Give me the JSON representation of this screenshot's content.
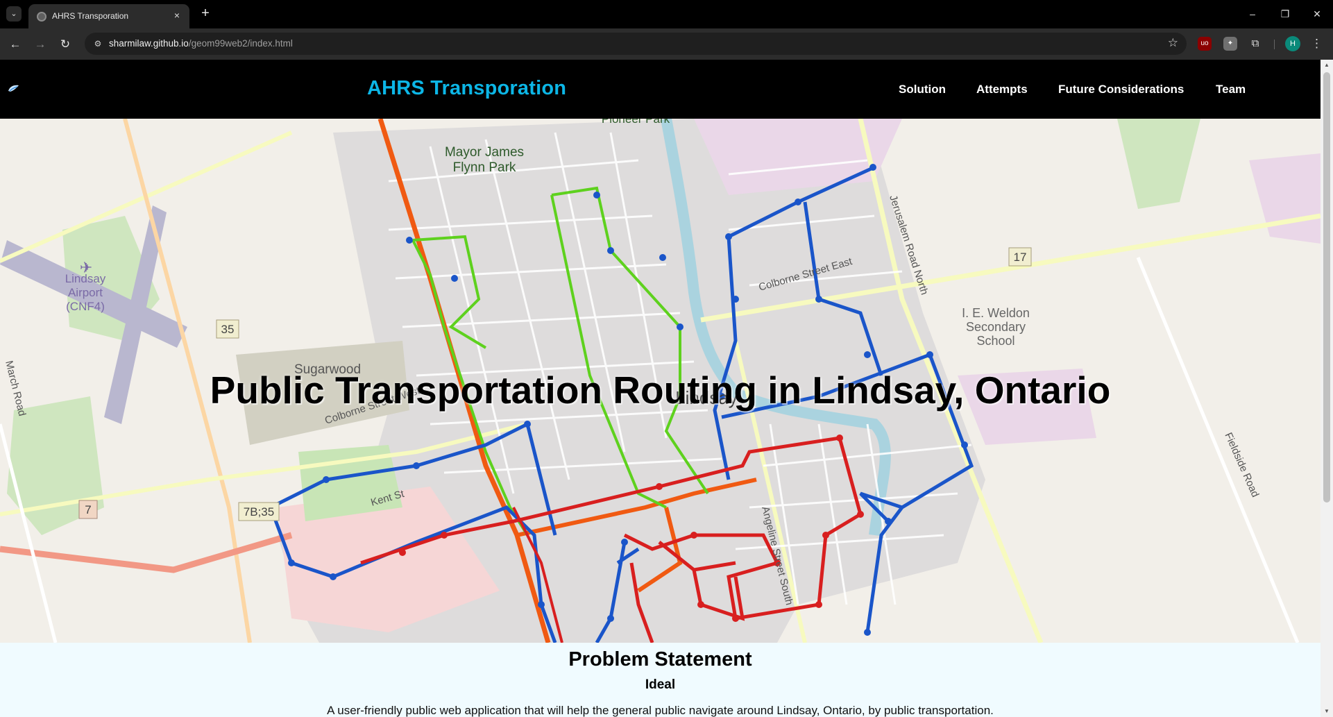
{
  "browser": {
    "tab_title": "AHRS Transporation",
    "tab_close": "×",
    "new_tab": "+",
    "url_host": "sharmilaw.github.io",
    "url_path": "/geom99web2/index.html",
    "window_controls": [
      "–",
      "❐",
      "✕"
    ],
    "avatar_letter": "H",
    "icons": [
      "tab-search-icon",
      "back-icon",
      "forward-icon",
      "reload-icon",
      "site-settings-icon",
      "bookmark-star-icon",
      "ublock-extension-icon",
      "extension-icon",
      "extensions-puzzle-icon",
      "menu-dots-icon"
    ]
  },
  "site": {
    "brand": "AHRS Transporation",
    "nav": [
      "Solution",
      "Attempts",
      "Future Considerations",
      "Team"
    ]
  },
  "hero": {
    "title": "Public Transportation Routing in Lindsay, Ontario",
    "map_labels": {
      "park": "Mayor James Flynn Park",
      "park_l1": "Mayor James",
      "park_l2": "Flynn Park",
      "airport_l1": "Lindsay",
      "airport_l2": "Airport",
      "airport_l3": "(CNF4)",
      "town": "Lindsay",
      "sugarwood": "Sugarwood",
      "school_l1": "I. E. Weldon",
      "school_l2": "Secondary",
      "school_l3": "School",
      "road_colborne": "Colborne Street East",
      "road_jerusalem": "Jerusalem Road North",
      "road_fieldside": "Fieldside Road",
      "road_angeline": "Angeline Street South",
      "road_kent": "Kent St",
      "road_march": "March Road",
      "road_colborne_w": "Colborne Street West",
      "park_top": "Pioneer Park",
      "shield_35": "35",
      "shield_17": "17",
      "shield_7": "7",
      "shield_7b35": "7B;35"
    }
  },
  "problem": {
    "title": "Problem Statement",
    "subtitle": "Ideal",
    "text": "A user-friendly public web application that will help the general public navigate around Lindsay, Ontario, by public transportation."
  },
  "colors": {
    "brand": "#0cb6e6",
    "route_blue": "#1a55c9",
    "route_red": "#d81f1f",
    "route_green": "#5ed11e",
    "route_orange": "#f05a12",
    "map_bg": "#f2efe9"
  }
}
